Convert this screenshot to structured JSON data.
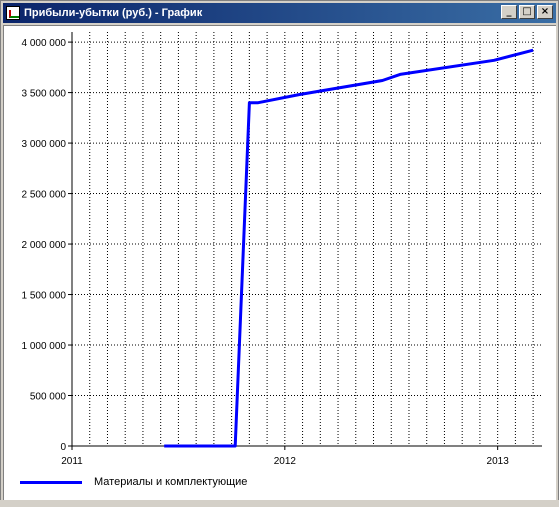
{
  "window": {
    "title": "Прибыли-убытки (руб.) - График",
    "buttons": {
      "minimize": "_",
      "maximize": "□",
      "close": "×"
    }
  },
  "chart_data": {
    "type": "line",
    "title": "",
    "xlabel": "",
    "ylabel": "",
    "ylim": [
      0,
      4100000
    ],
    "y_ticks": [
      0,
      500000,
      1000000,
      1500000,
      2000000,
      2500000,
      3000000,
      3500000,
      4000000
    ],
    "y_tick_labels": [
      "0",
      "500 000",
      "1 000 000",
      "1 500 000",
      "2 000 000",
      "2 500 000",
      "3 000 000",
      "3 500 000",
      "4 000 000"
    ],
    "x_tick_labels": [
      "2011",
      "2012",
      "2013"
    ],
    "x_unit": "month index from Jan 2011",
    "xlim": [
      0,
      26.5
    ],
    "x_ticks": [
      0,
      12,
      24
    ],
    "grid": true,
    "legend_position": "bottom-left",
    "series": [
      {
        "name": "Материалы и комплектующие",
        "color": "#0000ff",
        "points": [
          [
            5.2,
            0
          ],
          [
            9.2,
            0
          ],
          [
            10.0,
            3400000
          ],
          [
            10.5,
            3400000
          ],
          [
            12.8,
            3480000
          ],
          [
            17.5,
            3620000
          ],
          [
            18.5,
            3680000
          ],
          [
            23.8,
            3820000
          ],
          [
            26.0,
            3920000
          ]
        ]
      }
    ]
  }
}
